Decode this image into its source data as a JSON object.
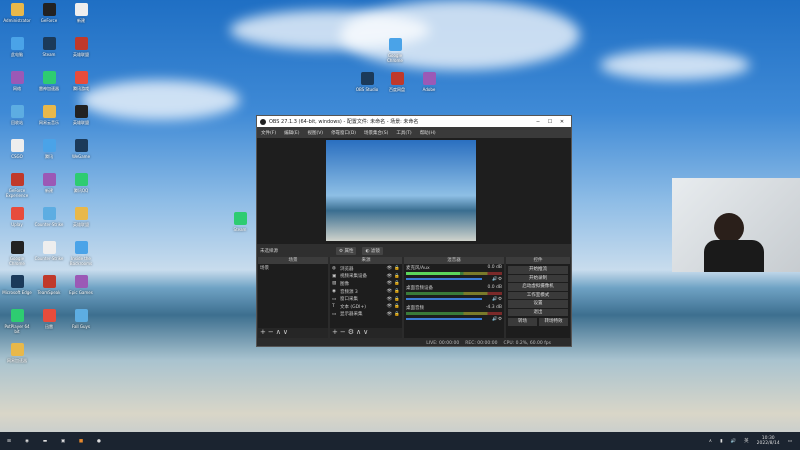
{
  "desktop": {
    "icons_left": [
      "Administrator",
      "GeForce",
      "新建",
      "此电脑",
      "Steam",
      "英雄联盟",
      "网络",
      "雷神加速器",
      "腾讯游戏",
      "回收站",
      "网易云音乐",
      "英雄联盟",
      "CSGO",
      "腾讯",
      "WeGame",
      "GeForce Experience",
      "新建",
      "腾讯QQ",
      "Uplay",
      "Counter-Strike",
      "英雄联盟",
      "Google Chrome",
      "Counter-Strike",
      "Inside the Backrooms",
      "Microsoft Edge",
      "TeamSpeak",
      "Epic Games",
      "PotPlayer 64 bit",
      "迅雷",
      "Fall Guys",
      "网易加速器"
    ],
    "icons_center": [
      "Google Chrome",
      "OBS Studio",
      "百度网盘",
      "Adobe",
      "Steam"
    ]
  },
  "obs": {
    "title": "OBS 27.1.3 (64-bit, windows) - 配置文件: 未命名 - 场景: 未命名",
    "menu": [
      "文件(F)",
      "编辑(E)",
      "视图(V)",
      "停靠窗口(D)",
      "场景集合(S)",
      "工具(T)",
      "帮助(H)"
    ],
    "context": {
      "label": "未选择源",
      "properties": "属性",
      "filters": "滤镜"
    },
    "docks": {
      "scenes": "场景",
      "sources": "来源",
      "mixer": "混音器",
      "controls": "控件"
    },
    "scenes": [
      "场景"
    ],
    "sources": [
      {
        "name": "浏览器",
        "icon": "globe"
      },
      {
        "name": "视频采集设备",
        "icon": "camera"
      },
      {
        "name": "图像",
        "icon": "image"
      },
      {
        "name": "音频源 3",
        "icon": "audio"
      },
      {
        "name": "窗口采集",
        "icon": "window"
      },
      {
        "name": "文本 (GDI+)",
        "icon": "text"
      },
      {
        "name": "显示器采集",
        "icon": "monitor"
      }
    ],
    "mixer": [
      {
        "name": "麦克风/Aux",
        "db": "0.0 dB",
        "level": 0.6
      },
      {
        "name": "桌面音频设备",
        "db": "0.0 dB",
        "level": 0
      },
      {
        "name": "桌面音频",
        "db": "-4.3 dB",
        "level": 0
      }
    ],
    "controls": [
      "开始推流",
      "开始录制",
      "启动虚拟摄像机",
      "工作室模式",
      "设置",
      "退出"
    ],
    "transition": [
      "转场",
      "转场特效"
    ],
    "status": {
      "live": "LIVE: 00:00:00",
      "rec": "REC: 00:00:00",
      "cpu": "CPU: 0.2%, 60.00 fps"
    }
  },
  "taskbar": {
    "time": "10:30",
    "date": "2022/8/14"
  }
}
